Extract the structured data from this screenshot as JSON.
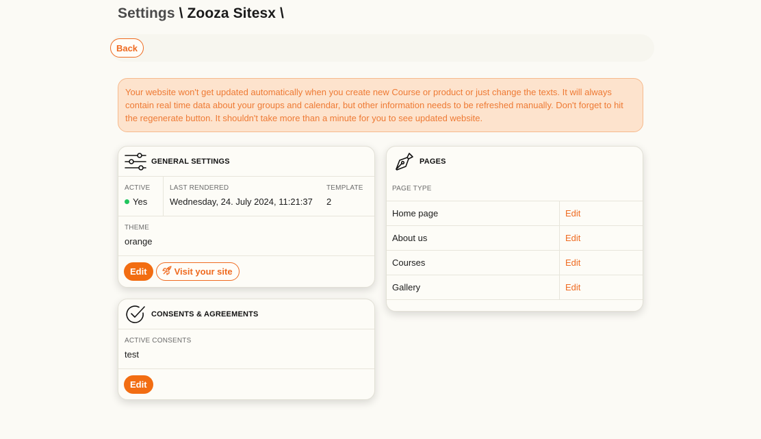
{
  "header": {
    "crumb_settings": "Settings",
    "separator": "\\",
    "site_name": "Zooza Sitesx",
    "trailing_separator": "\\"
  },
  "toolbar": {
    "back_label": "Back"
  },
  "alert": {
    "text": "Your website won't get updated automatically when you create new Course or product or just change the texts. It will always contain real time data about your groups and calendar, but other information needs to be refreshed manually. Don't forget to hit the regenerate button. It shouldn't take more than a minute for you to see updated website."
  },
  "general_settings": {
    "title": "GENERAL SETTINGS",
    "icon": "sliders-icon",
    "active_label": "ACTIVE",
    "active_value": "Yes",
    "active_status_color": "#21c55d",
    "last_rendered_label": "LAST RENDERED",
    "last_rendered_value": "Wednesday, 24. July 2024, 11:21:37",
    "template_label": "TEMPLATE",
    "template_value": "2",
    "theme_label": "THEME",
    "theme_value": "orange",
    "edit_label": "Edit",
    "visit_label": "Visit your site",
    "visit_icon": "rocket-icon"
  },
  "consents": {
    "title": "CONSENTS & AGREEMENTS",
    "icon": "check-circle-icon",
    "active_consents_label": "ACTIVE CONSENTS",
    "active_consents_value": "test",
    "edit_label": "Edit"
  },
  "pages": {
    "title": "PAGES",
    "icon": "pen-nib-icon",
    "page_type_label": "PAGE TYPE",
    "rows": [
      {
        "name": "Home page",
        "action": "Edit"
      },
      {
        "name": "About us",
        "action": "Edit"
      },
      {
        "name": "Courses",
        "action": "Edit"
      },
      {
        "name": "Gallery",
        "action": "Edit"
      }
    ]
  },
  "colors": {
    "accent": "#f26d12",
    "alert_bg": "#fde3cd",
    "alert_text": "#ee7a34",
    "page_bg": "#fbfaf5"
  }
}
